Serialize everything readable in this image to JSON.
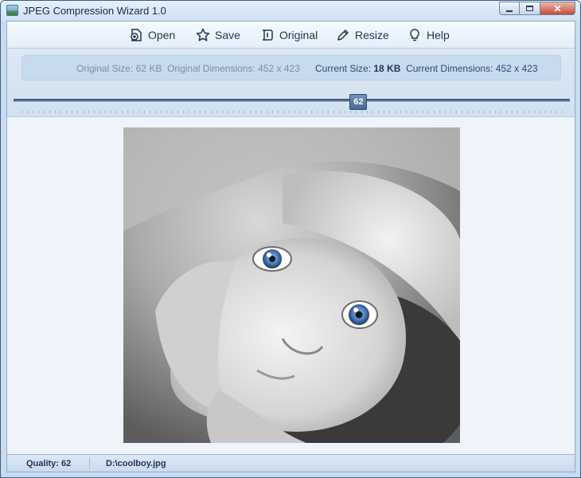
{
  "window": {
    "title": "JPEG Compression Wizard 1.0"
  },
  "toolbar": {
    "open": "Open",
    "save": "Save",
    "original": "Original",
    "resize": "Resize",
    "help": "Help"
  },
  "info": {
    "original_size_label": "Original Size:",
    "original_size": "62 KB",
    "original_dims_label": "Original Dimensions:",
    "original_dims": "452 x 423",
    "current_size_label": "Current Size:",
    "current_size": "18 KB",
    "current_dims_label": "Current Dimensions:",
    "current_dims": "452 x 423"
  },
  "slider": {
    "value": 62,
    "min": 0,
    "max": 100,
    "label": "62"
  },
  "status": {
    "quality": "Quality: 62",
    "file": "D:\\coolboy.jpg"
  },
  "colors": {
    "accent": "#4b6890",
    "eyes": "#4a78b8"
  },
  "icons": {
    "open": "open-file-icon",
    "save": "star-icon",
    "original": "revert-icon",
    "resize": "pencil-icon",
    "help": "lightbulb-icon"
  }
}
